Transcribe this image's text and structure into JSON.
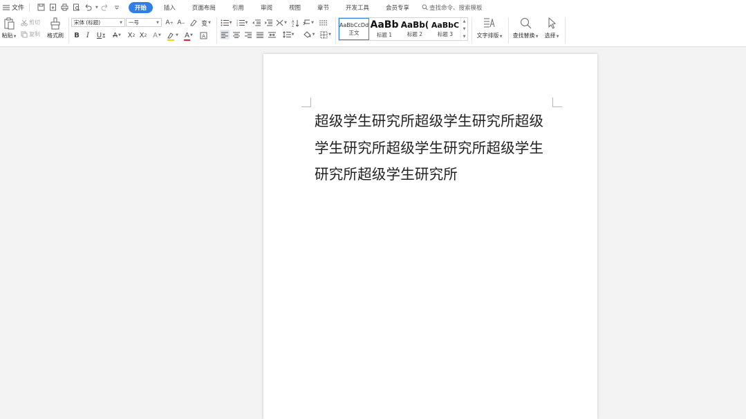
{
  "menu": {
    "file_label": "文件",
    "tabs": [
      {
        "label": "开始",
        "active": true
      },
      {
        "label": "插入",
        "active": false
      },
      {
        "label": "页面布局",
        "active": false
      },
      {
        "label": "引用",
        "active": false
      },
      {
        "label": "审阅",
        "active": false
      },
      {
        "label": "视图",
        "active": false
      },
      {
        "label": "章节",
        "active": false
      },
      {
        "label": "开发工具",
        "active": false
      },
      {
        "label": "会员专享",
        "active": false
      }
    ],
    "search_placeholder": "查找命令、搜索模板"
  },
  "ribbon": {
    "paste_label": "粘贴",
    "cut_label": "剪切",
    "copy_label": "复制",
    "format_painter_label": "格式刷",
    "font_name": "宋体 (标题)",
    "font_size": "一号",
    "styles": [
      {
        "preview": "AaBbCcDd",
        "name": "正文"
      },
      {
        "preview": "AaBb",
        "name": "标题 1"
      },
      {
        "preview": "AaBb(",
        "name": "标题 2"
      },
      {
        "preview": "AaBbC",
        "name": "标题 3"
      }
    ],
    "text_layout_label": "文字排版",
    "find_replace_label": "查找替换",
    "select_label": "选择"
  },
  "document": {
    "body_text": "超级学生研究所超级学生研究所超级学生研究所超级学生研究所超级学生研究所超级学生研究所"
  },
  "colors": {
    "accent": "#2f7fe4",
    "font_color_underline": "#d8262b",
    "highlight_underline": "#f2d21b"
  }
}
